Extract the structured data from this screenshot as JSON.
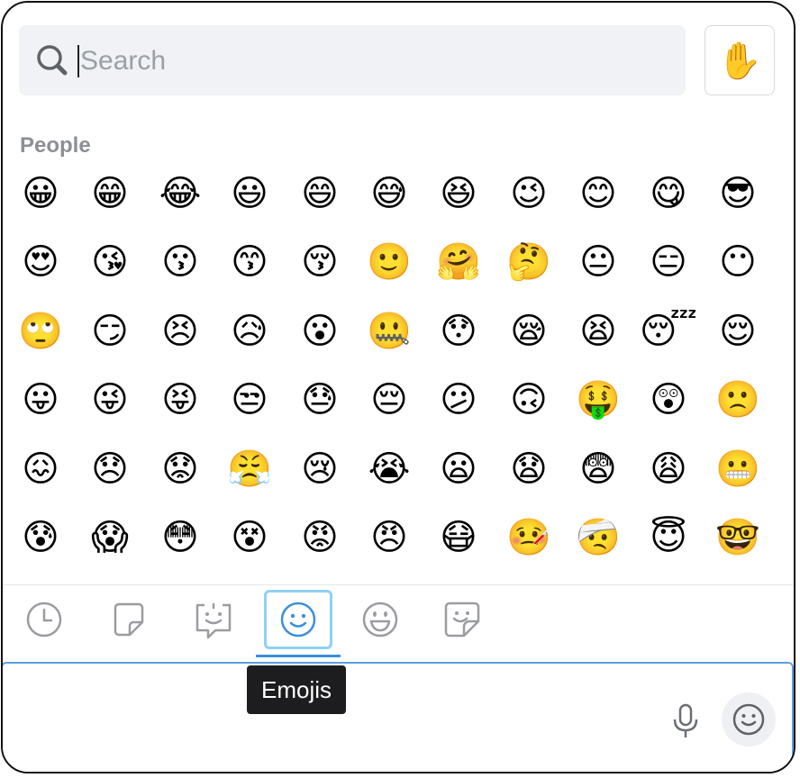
{
  "search": {
    "placeholder": "Search",
    "value": ""
  },
  "skin_tone_button": {
    "glyph": "✋"
  },
  "category": {
    "label": "People"
  },
  "emojis": [
    "😀",
    "😁",
    "😂",
    "😃",
    "😄",
    "😅",
    "😆",
    "😉",
    "😊",
    "😋",
    "😎",
    "😍",
    "😘",
    "😗",
    "😙",
    "😚",
    "🙂",
    "🤗",
    "🤔",
    "😐",
    "😑",
    "😶",
    "🙄",
    "😏",
    "😣",
    "😥",
    "😮",
    "🤐",
    "😯",
    "😪",
    "😫",
    "😴",
    "😌",
    "😛",
    "😜",
    "😝",
    "😒",
    "😓",
    "😔",
    "😕",
    "🙃",
    "🤑",
    "😲",
    "🙁",
    "😖",
    "😞",
    "😟",
    "😤",
    "😢",
    "😭",
    "😦",
    "😧",
    "😨",
    "😩",
    "😬",
    "😰",
    "😱",
    "😳",
    "😵",
    "😡",
    "😠",
    "😷",
    "🤒",
    "🤕",
    "😇",
    "🤓"
  ],
  "tabs": [
    {
      "name": "recent",
      "icon": "clock-icon"
    },
    {
      "name": "stickers-1",
      "icon": "sticker-note-icon"
    },
    {
      "name": "stickers-2",
      "icon": "speech-face-icon"
    },
    {
      "name": "emojis",
      "icon": "smiley-icon",
      "active": true
    },
    {
      "name": "faces",
      "icon": "grin-icon"
    },
    {
      "name": "stickers-3",
      "icon": "sticker-smile-icon"
    }
  ],
  "tooltip": {
    "label": "Emojis"
  },
  "colors": {
    "accent": "#3b8fd9",
    "active_border": "#8fd0f5",
    "search_bg": "#f1f2f5"
  }
}
